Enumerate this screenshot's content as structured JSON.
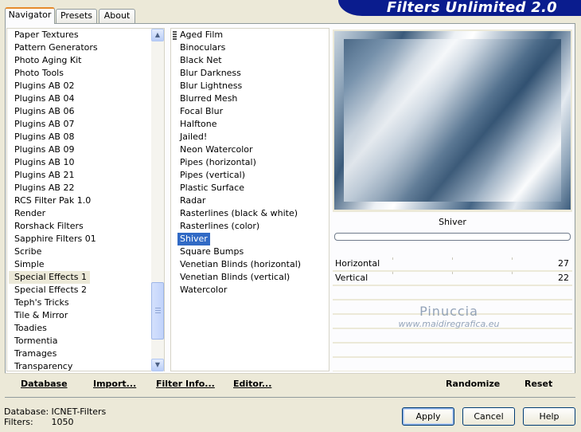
{
  "app": {
    "title": "Filters Unlimited 2.0"
  },
  "tabs": [
    {
      "label": "Navigator",
      "active": true
    },
    {
      "label": "Presets",
      "active": false
    },
    {
      "label": "About",
      "active": false
    }
  ],
  "categories": {
    "items": [
      "Paper Textures",
      "Pattern Generators",
      "Photo Aging Kit",
      "Photo Tools",
      "Plugins AB 02",
      "Plugins AB 04",
      "Plugins AB 06",
      "Plugins AB 07",
      "Plugins AB 08",
      "Plugins AB 09",
      "Plugins AB 10",
      "Plugins AB 21",
      "Plugins AB 22",
      "RCS Filter Pak 1.0",
      "Render",
      "Rorshack Filters",
      "Sapphire Filters 01",
      "Scribe",
      "Simple",
      "Special Effects 1",
      "Special Effects 2",
      "Teph's Tricks",
      "Tile & Mirror",
      "Toadies",
      "Tormentia",
      "Tramages",
      "Transparency"
    ],
    "selected": "Special Effects 1",
    "scroll_icons": {
      "up": "scroll-up-icon",
      "down": "scroll-down-icon"
    }
  },
  "filters": {
    "items": [
      "Aged Film",
      "Binoculars",
      "Black Net",
      "Blur Darkness",
      "Blur Lightness",
      "Blurred Mesh",
      "Focal Blur",
      "Halftone",
      "Jailed!",
      "Neon Watercolor",
      "Pipes (horizontal)",
      "Pipes (vertical)",
      "Plastic Surface",
      "Radar",
      "Rasterlines (black & white)",
      "Rasterlines (color)",
      "Shiver",
      "Square Bumps",
      "Venetian Blinds (horizontal)",
      "Venetian Blinds (vertical)",
      "Watercolor"
    ],
    "selected": "Shiver"
  },
  "preview": {
    "filter_name": "Shiver"
  },
  "parameters": [
    {
      "label": "Horizontal",
      "value": "27"
    },
    {
      "label": "Vertical",
      "value": "22"
    }
  ],
  "watermark": {
    "name": "Pinuccia",
    "url": "www.maidiregrafica.eu"
  },
  "bottom_bar": {
    "database": "Database",
    "import": "Import...",
    "filter_info": "Filter Info...",
    "editor": "Editor...",
    "randomize": "Randomize",
    "reset": "Reset"
  },
  "status": {
    "database_label": "Database:",
    "database_value": "ICNET-Filters",
    "filters_label": "Filters:",
    "filters_value": "1050"
  },
  "buttons": {
    "apply": "Apply",
    "cancel": "Cancel",
    "help": "Help"
  },
  "colors": {
    "selection": "#316ac5",
    "banner": "#0a1c8e",
    "panel": "#ece9d8"
  }
}
